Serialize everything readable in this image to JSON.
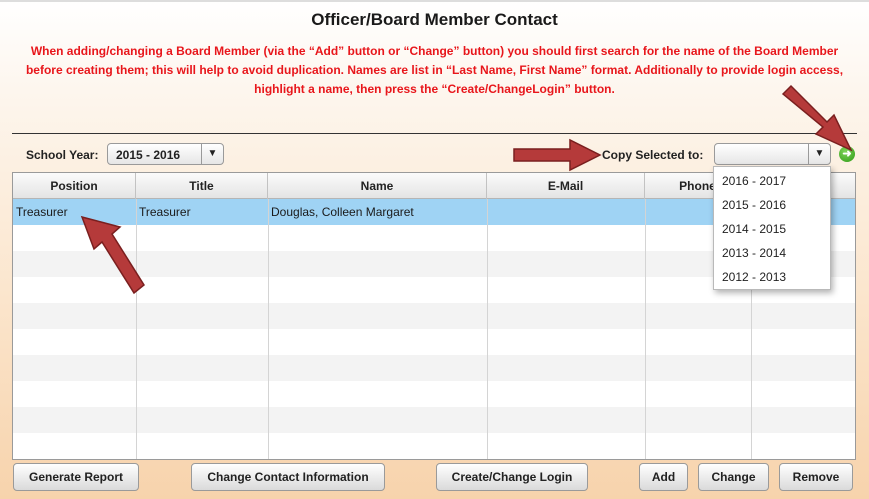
{
  "page": {
    "title": "Officer/Board Member Contact",
    "instructions": "When adding/changing a Board Member (via the “Add” button or “Change” button) you should first search for the name of the Board Member before creating them; this will help to avoid duplication. Names are list in “Last Name, First Name” format. Additionally to provide login access, highlight a name, then press the “Create/ChangeLogin” button."
  },
  "filters": {
    "school_year_label": "School Year:",
    "school_year_value": "2015 - 2016",
    "copy_label": "Copy Selected to:",
    "copy_value": "",
    "copy_options": [
      "2016 - 2017",
      "2015 - 2016",
      "2014 - 2015",
      "2013 - 2014",
      "2012 - 2013"
    ]
  },
  "table": {
    "columns": [
      "Position",
      "Title",
      "Name",
      "E-Mail",
      "Phone",
      ""
    ],
    "rows": [
      {
        "position": "Treasurer",
        "title": "Treasurer",
        "name": "Douglas, Colleen Margaret",
        "email": "",
        "phone": "",
        "extra": ""
      }
    ]
  },
  "buttons": {
    "generate_report": "Generate Report",
    "change_contact": "Change Contact Information",
    "create_login": "Create/Change Login",
    "add": "Add",
    "change": "Change",
    "remove": "Remove"
  },
  "icons": {
    "go": "arrow-right-circle-icon",
    "dropdown": "chevron-down-icon",
    "annotation": "red-arrow-icon"
  },
  "colors": {
    "instruction_text": "#e8161b",
    "selected_row": "#9fd3f4",
    "annotation_arrow": "#b53a3a"
  }
}
